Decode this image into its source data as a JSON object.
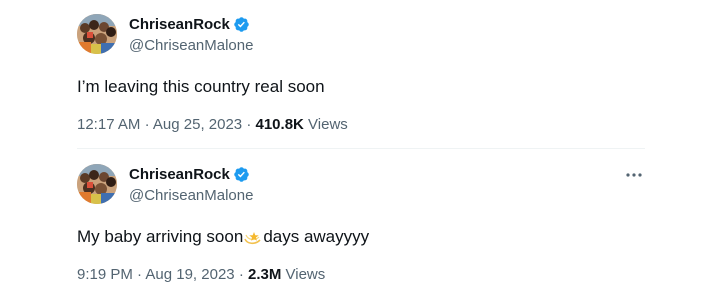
{
  "tweets": [
    {
      "author": {
        "display_name": "ChriseanRock",
        "handle": "@ChriseanMalone",
        "verified": true
      },
      "text_before": "I’m leaving this country real soon",
      "text_after": "",
      "time": "12:17 AM",
      "separator": "·",
      "date": "Aug 25, 2023",
      "views_count": "410.8K",
      "views_label": "Views",
      "show_more_menu": false
    },
    {
      "author": {
        "display_name": "ChriseanRock",
        "handle": "@ChriseanMalone",
        "verified": true
      },
      "text_before": "My baby arriving soon",
      "emoji": "dizzy-star-emoji",
      "text_after": "days awayyyy",
      "time": "9:19 PM",
      "separator": "·",
      "date": "Aug 19, 2023",
      "views_count": "2.3M",
      "views_label": "Views",
      "show_more_menu": true
    }
  ],
  "colors": {
    "verified_blue": "#1d9bf0",
    "secondary_text": "#536471",
    "primary_text": "#0f1419",
    "divider": "#eff3f4"
  }
}
